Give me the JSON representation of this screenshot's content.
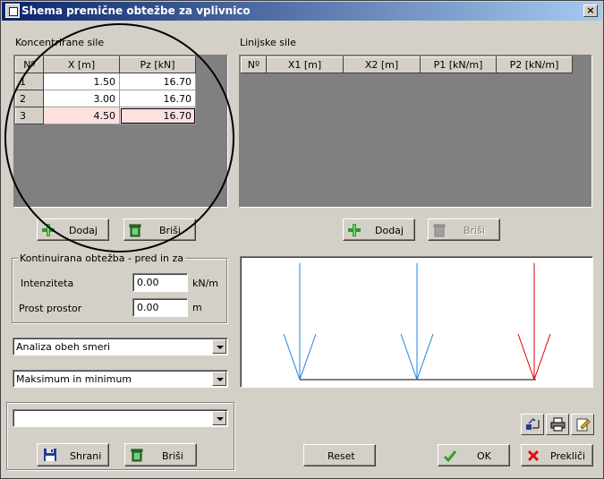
{
  "window": {
    "title": "Shema premične obtežbe za vplivnico",
    "close_label": "×"
  },
  "concentrated": {
    "label": "Koncentrirane sile",
    "columns": [
      "Nº",
      "X [m]",
      "Pz [kN]"
    ],
    "rows": [
      {
        "n": "1",
        "x": "1.50",
        "pz": "16.70"
      },
      {
        "n": "2",
        "x": "3.00",
        "pz": "16.70"
      },
      {
        "n": "3",
        "x": "4.50",
        "pz": "16.70"
      }
    ],
    "add_label": "Dodaj",
    "delete_label": "Briši"
  },
  "linear": {
    "label": "Linijske sile",
    "columns": [
      "Nº",
      "X1 [m]",
      "X2 [m]",
      "P1 [kN/m]",
      "P2 [kN/m]"
    ],
    "add_label": "Dodaj",
    "delete_label": "Briši"
  },
  "continuous": {
    "label": "Kontinuirana obtežba - pred in za",
    "intensity_label": "Intenziteta",
    "intensity_value": "0.00",
    "intensity_unit": "kN/m",
    "free_space_label": "Prost prostor",
    "free_space_value": "0.00",
    "free_space_unit": "m"
  },
  "analysis_select": "Analiza obeh smeri",
  "extreme_select": "Maksimum in minimum",
  "preset": {
    "value": "",
    "save_label": "Shrani",
    "delete_label": "Briši"
  },
  "footer": {
    "reset_label": "Reset",
    "ok_label": "OK",
    "cancel_label": "Prekliči"
  },
  "colors": {
    "arrow_blue": "#2080e0",
    "arrow_red": "#e00000",
    "selected_row": "#ffe0e0"
  },
  "icons": {
    "add": "plus-icon",
    "delete": "trash-icon",
    "save": "floppy-icon",
    "ok": "checkmark-icon",
    "cancel": "cross-icon",
    "tool1": "chart-tool-icon",
    "tool2": "printer-icon",
    "tool3": "edit-icon"
  }
}
